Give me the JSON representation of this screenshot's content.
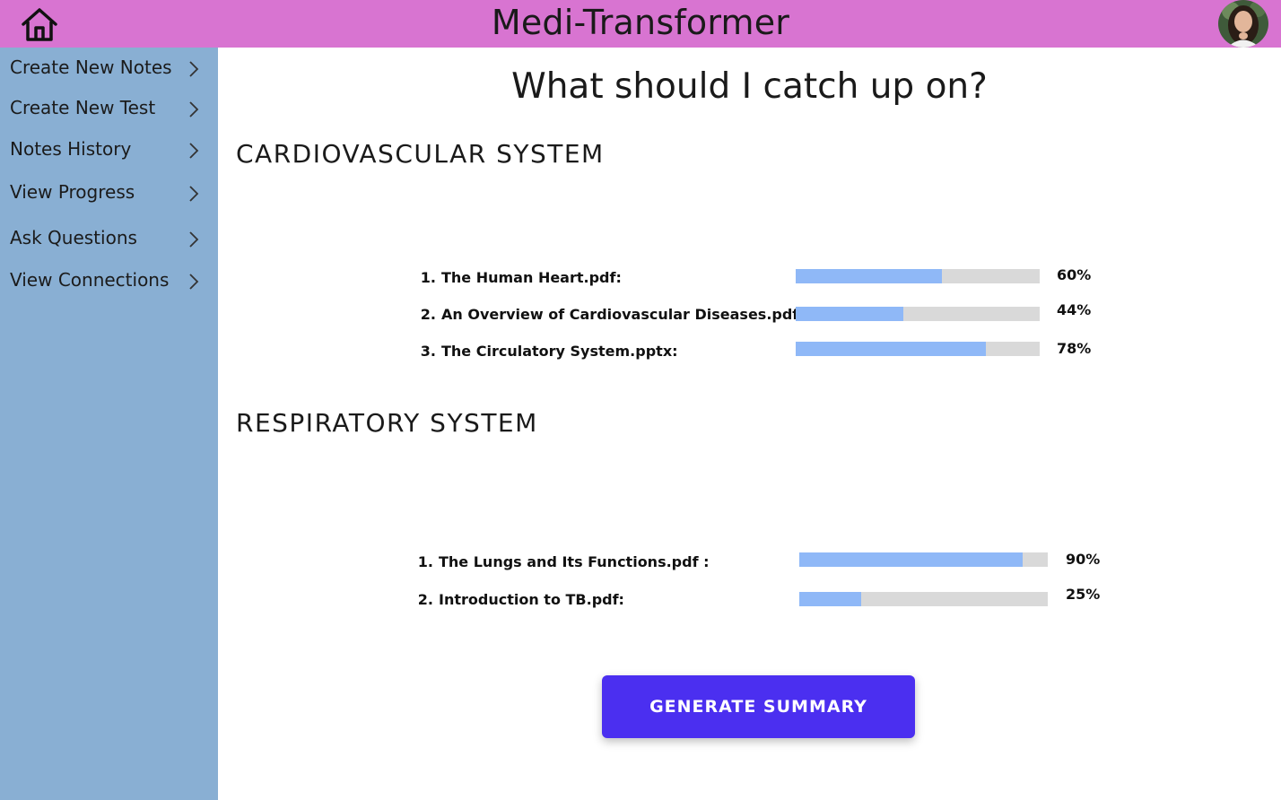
{
  "header": {
    "title": "Medi-Transformer",
    "home_icon": "home-icon",
    "avatar_icon": "user-avatar"
  },
  "sidebar": {
    "items": [
      {
        "label": "Create New Notes"
      },
      {
        "label": "Create New Test"
      },
      {
        "label": "Notes History"
      },
      {
        "label": "View Progress"
      },
      {
        "label": "Ask Questions"
      },
      {
        "label": "View Connections"
      }
    ]
  },
  "main": {
    "heading": "What should I catch up on?",
    "sections": [
      {
        "title": "CARDIOVASCULAR SYSTEM",
        "rows": [
          {
            "num": "1.",
            "name": "The Human Heart.pdf:",
            "percent_label": "60%",
            "progress": 0.6
          },
          {
            "num": "2.",
            "name": "An Overview of Cardiovascular Diseases.pdf:",
            "percent_label": "44%",
            "progress": 0.44
          },
          {
            "num": "3.",
            "name": "The Circulatory System.pptx:",
            "percent_label": "78%",
            "progress": 0.78
          }
        ]
      },
      {
        "title": "RESPIRATORY SYSTEM",
        "rows": [
          {
            "num": "1.",
            "name": "The Lungs and Its Functions.pdf :",
            "percent_label": "90%",
            "progress": 0.9
          },
          {
            "num": "2.",
            "name": "Introduction to TB.pdf:",
            "percent_label": "25%",
            "progress": 0.25
          }
        ]
      }
    ],
    "generate_button": "GENERATE SUMMARY"
  },
  "colors": {
    "header_bg": "#d874d1",
    "sidebar_bg": "#89afd3",
    "bar_fill": "#8fb8f7",
    "bar_track": "#d9d9d9",
    "button_bg": "#4b2ff0"
  }
}
